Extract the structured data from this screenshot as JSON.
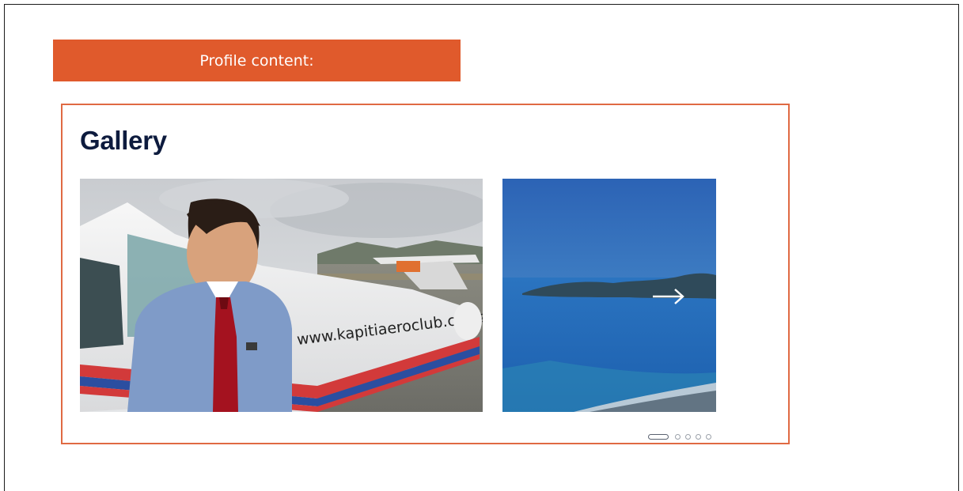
{
  "banner": {
    "label": "Profile content:"
  },
  "gallery": {
    "title": "Gallery",
    "slides": [
      {
        "caption_on_plane": "www.kapitiaeroclub.co.nz"
      },
      {}
    ],
    "pager": {
      "count": 5,
      "active_index": 0
    },
    "next_icon": "arrow-right-icon"
  },
  "colors": {
    "banner_bg": "#e05a2c",
    "panel_border": "#e06a43",
    "title_text": "#0d1b3e"
  }
}
